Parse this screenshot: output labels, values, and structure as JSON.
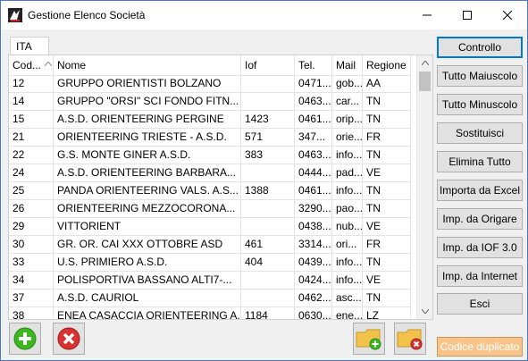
{
  "window": {
    "title": "Gestione Elenco Società"
  },
  "tabs": [
    {
      "label": "ITA"
    }
  ],
  "grid": {
    "columns": [
      "Cod...",
      "Nome",
      "Iof",
      "Tel.",
      "Mail",
      "Regione"
    ],
    "rows": [
      [
        "12",
        "GRUPPO ORIENTISTI BOLZANO",
        "",
        "0471...",
        "gob...",
        "AA"
      ],
      [
        "14",
        "GRUPPO \"ORSI\" SCI FONDO FITN...",
        "",
        "0463...",
        "car...",
        "TN"
      ],
      [
        "15",
        "A.S.D. ORIENTEERING PERGINE",
        "1423",
        "0461...",
        "orip...",
        "TN"
      ],
      [
        "21",
        "ORIENTEERING TRIESTE - A.S.D.",
        "571",
        "347...",
        "orie...",
        "FR"
      ],
      [
        "22",
        "G.S. MONTE GINER A.S.D.",
        "383",
        "0463...",
        "info...",
        "TN"
      ],
      [
        "24",
        "A.S.D.  ORIENTEERING  BARBARA...",
        "",
        "0444...",
        "pad...",
        "VE"
      ],
      [
        "25",
        "PANDA  ORIENTEERING  VALS.  A.S...",
        "1388",
        "0461...",
        "info...",
        "TN"
      ],
      [
        "26",
        "ORIENTEERING  MEZZOCORONA...",
        "",
        "3290...",
        "pao...",
        "TN"
      ],
      [
        "29",
        "VITTORIENT",
        "",
        "0438...",
        "nub...",
        "VE"
      ],
      [
        "30",
        "GR. OR. CAI XXX OTTOBRE ASD",
        "461",
        "3314...",
        "ori...",
        "FR"
      ],
      [
        "33",
        "U.S. PRIMIERO A.S.D.",
        "404",
        "0439...",
        "info...",
        "TN"
      ],
      [
        "34",
        "POLISPORTIVA  BASSANO  ALTI7-...",
        "",
        "0424...",
        "info...",
        "VE"
      ],
      [
        "37",
        "A.S.D. CAURIOL",
        "",
        "0462...",
        "asc...",
        "TN"
      ],
      [
        "38",
        "ENEA  CASACCIA  ORIENTEERING  A...",
        "1184",
        "0630...",
        "ene...",
        "LZ"
      ]
    ]
  },
  "side_buttons": [
    {
      "label": "Controllo",
      "default": true
    },
    {
      "label": "Tutto Maiuscolo"
    },
    {
      "label": "Tutto Minuscolo"
    },
    {
      "label": "Sostituisci"
    },
    {
      "label": "Elimina Tutto"
    },
    {
      "label": "Importa da Excel"
    },
    {
      "label": "Imp. da Origare"
    },
    {
      "label": "Imp. da IOF 3.0"
    },
    {
      "label": "Imp. da Internet"
    },
    {
      "label": "Esci"
    }
  ],
  "duplicate_button": {
    "label": "Codice duplicato"
  },
  "colors": {
    "add": "#3cb81e",
    "delete": "#d83232",
    "folder": "#f3c24a",
    "dup_bg": "#f9c48a",
    "accent": "#0078d7"
  },
  "icons": [
    "app-icon",
    "minimize-icon",
    "maximize-icon",
    "close-icon",
    "add-icon",
    "delete-icon",
    "folder-add-icon",
    "folder-delete-icon"
  ]
}
